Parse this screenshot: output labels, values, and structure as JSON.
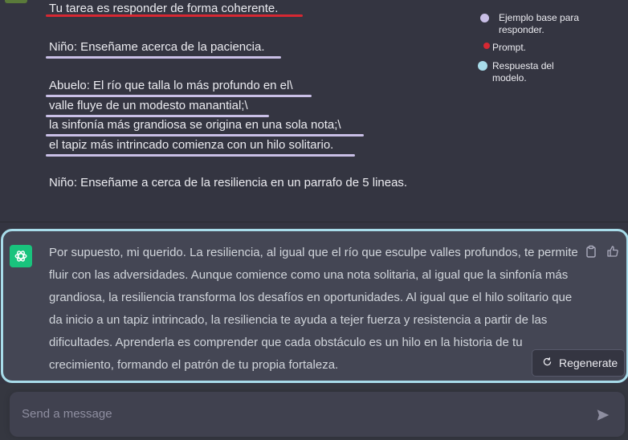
{
  "prompt": {
    "instruction": "Tu tarea es responder de forma coherente.",
    "child_line_1": "Niño: Enseñame acerca de la paciencia.",
    "grandpa_lines": [
      "Abuelo: El río que talla lo más profundo en el\\",
      "valle fluye de un modesto manantial;\\",
      "la sinfonía más grandiosa se origina en una sola nota;\\",
      "el tapiz más intrincado comienza con un hilo solitario."
    ],
    "child_line_2": "Niño: Enseñame a cerca de la resiliencia en un parrafo de 5 lineas."
  },
  "legend": {
    "base_label": "Ejemplo base para\nresponder.",
    "prompt_label": "Prompt.",
    "response_label": "Respuesta del\nmodelo.",
    "colors": {
      "base": "#c9bfe6",
      "prompt": "#d62832",
      "response": "#a8dcea"
    }
  },
  "response": {
    "text": "Por supuesto, mi querido. La resiliencia, al igual que el río que esculpe valles profundos, te permite fluir con las adversidades. Aunque comience como una nota solitaria, al igual que la sinfonía más grandiosa, la resiliencia transforma los desafíos en oportunidades. Al igual que el hilo solitario que da inicio a un tapiz intrincado, la resiliencia te ayuda a tejer fuerza y resistencia a partir de las dificultades. Aprenderla es comprender que cada obstáculo es un hilo en la historia de tu crecimiento, formando el patrón de tu propia fortaleza.",
    "regenerate_label": "Regenerate"
  },
  "composer": {
    "placeholder": "Send a message"
  },
  "icons": [
    "clipboard-icon",
    "thumbs-up-icon",
    "refresh-icon",
    "send-icon",
    "openai-logo-icon"
  ]
}
